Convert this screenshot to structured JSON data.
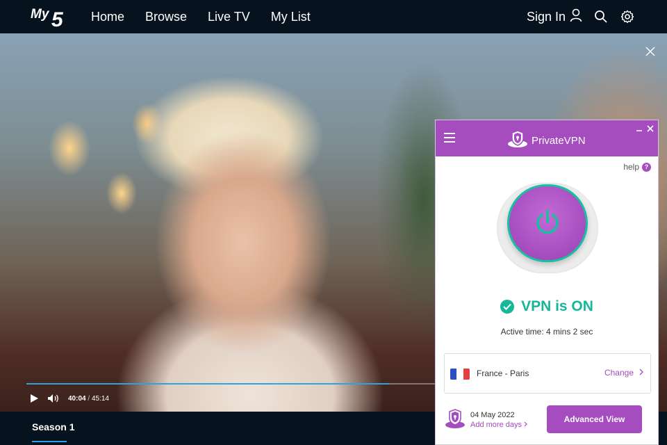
{
  "nav": {
    "logo": "My5",
    "links": [
      "Home",
      "Browse",
      "Live TV",
      "My List"
    ],
    "sign_in": "Sign In",
    "icons": [
      "user-icon",
      "search-icon",
      "gear-icon"
    ]
  },
  "player": {
    "current_time": "40:04",
    "separator": "/",
    "duration": "45:14",
    "progress": 0.886
  },
  "bottom": {
    "season_tab": "Season 1"
  },
  "vpn": {
    "brand": "PrivateVPN",
    "help": "help",
    "help_glyph": "?",
    "status": "VPN is ON",
    "active_time": "Active time: 4 mins 2 sec",
    "location": "France - Paris",
    "change": "Change",
    "subscription_date": "04 May 2022",
    "add_more_days": "Add more days",
    "advanced_view": "Advanced View",
    "colors": {
      "accent": "#a54cbf",
      "status": "#14b79a"
    }
  }
}
